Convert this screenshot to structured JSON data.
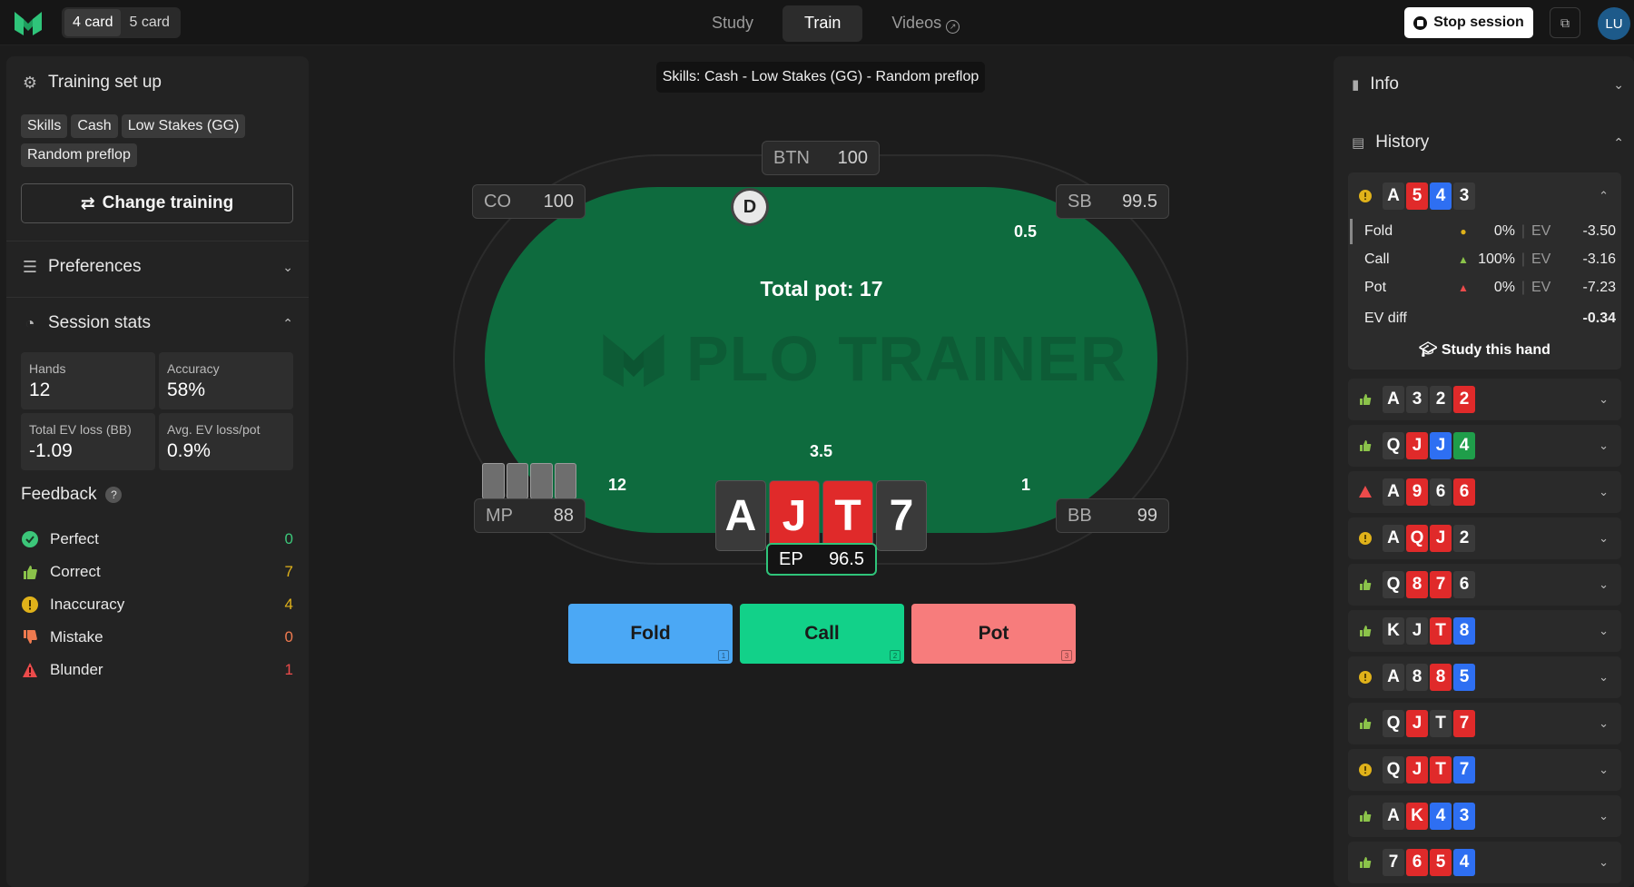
{
  "topbar": {
    "card_modes": [
      "4 card",
      "5 card"
    ],
    "active_mode": "4 card",
    "tabs": [
      "Study",
      "Train",
      "Videos"
    ],
    "active_tab": "Train",
    "stop_label": "Stop session",
    "avatar": "LU"
  },
  "training": {
    "title": "Training set up",
    "tags": [
      "Skills",
      "Cash",
      "Low Stakes (GG)",
      "Random preflop"
    ],
    "change_label": "Change training"
  },
  "preferences": {
    "title": "Preferences"
  },
  "session": {
    "title": "Session stats",
    "hands_label": "Hands",
    "hands": "12",
    "accuracy_label": "Accuracy",
    "accuracy": "58%",
    "evloss_label": "Total EV loss (BB)",
    "evloss": "-1.09",
    "avgloss_label": "Avg. EV loss/pot",
    "avgloss": "0.9%"
  },
  "feedback": {
    "title": "Feedback",
    "rows": [
      {
        "label": "Perfect",
        "count": "0",
        "color": "#3cc77a"
      },
      {
        "label": "Correct",
        "count": "7",
        "color": "#8bc34a"
      },
      {
        "label": "Inaccuracy",
        "count": "4",
        "color": "#e0b21a"
      },
      {
        "label": "Mistake",
        "count": "0",
        "color": "#ef7a4f"
      },
      {
        "label": "Blunder",
        "count": "1",
        "color": "#ec4b4b"
      }
    ]
  },
  "table": {
    "banner": "Skills: Cash - Low Stakes (GG) - Random preflop",
    "watermark": "PLO TRAINER",
    "pot": "Total pot: 17",
    "dealer": "D",
    "seats": {
      "btn": {
        "pos": "BTN",
        "stack": "100"
      },
      "co": {
        "pos": "CO",
        "stack": "100"
      },
      "sb": {
        "pos": "SB",
        "stack": "99.5"
      },
      "mp": {
        "pos": "MP",
        "stack": "88"
      },
      "bb": {
        "pos": "BB",
        "stack": "99"
      },
      "ep": {
        "pos": "EP",
        "stack": "96.5"
      }
    },
    "bets": {
      "sb": "0.5",
      "ep": "3.5",
      "mp": "12",
      "bb": "1"
    },
    "hero_cards": [
      {
        "rank": "A",
        "suit_color": "#3a3a3a"
      },
      {
        "rank": "J",
        "suit_color": "#e02a2a"
      },
      {
        "rank": "T",
        "suit_color": "#e02a2a"
      },
      {
        "rank": "7",
        "suit_color": "#3a3a3a"
      }
    ],
    "actions": [
      {
        "label": "Fold",
        "key": "1",
        "color": "#4ba8f5"
      },
      {
        "label": "Call",
        "key": "2",
        "color": "#12d189"
      },
      {
        "label": "Pot",
        "key": "3",
        "color": "#f77c7c"
      }
    ]
  },
  "info": {
    "title": "Info"
  },
  "history": {
    "title": "History",
    "expanded": {
      "cards": [
        {
          "rank": "A",
          "color": "#3a3a3a"
        },
        {
          "rank": "5",
          "color": "#e02a2a"
        },
        {
          "rank": "4",
          "color": "#2e6ff2"
        },
        {
          "rank": "3",
          "color": "#3a3a3a"
        }
      ],
      "rows": [
        {
          "action": "Fold",
          "pct": "0%",
          "ev_label": "EV",
          "ev": "-3.50"
        },
        {
          "action": "Call",
          "pct": "100%",
          "ev_label": "EV",
          "ev": "-3.16"
        },
        {
          "action": "Pot",
          "pct": "0%",
          "ev_label": "EV",
          "ev": "-7.23"
        }
      ],
      "evdiff_label": "EV diff",
      "evdiff": "-0.34",
      "study_label": "Study this hand"
    },
    "hands": [
      {
        "result": "correct",
        "cards": [
          [
            "A",
            "#3a3a3a"
          ],
          [
            "3",
            "#3a3a3a"
          ],
          [
            "2",
            "#3a3a3a"
          ],
          [
            "2",
            "#e02a2a"
          ]
        ]
      },
      {
        "result": "correct",
        "cards": [
          [
            "Q",
            "#3a3a3a"
          ],
          [
            "J",
            "#e02a2a"
          ],
          [
            "J",
            "#2e6ff2"
          ],
          [
            "4",
            "#1f9e4a"
          ]
        ]
      },
      {
        "result": "blunder",
        "cards": [
          [
            "A",
            "#3a3a3a"
          ],
          [
            "9",
            "#e02a2a"
          ],
          [
            "6",
            "#3a3a3a"
          ],
          [
            "6",
            "#e02a2a"
          ]
        ]
      },
      {
        "result": "inaccuracy",
        "cards": [
          [
            "A",
            "#3a3a3a"
          ],
          [
            "Q",
            "#e02a2a"
          ],
          [
            "J",
            "#e02a2a"
          ],
          [
            "2",
            "#3a3a3a"
          ]
        ]
      },
      {
        "result": "correct",
        "cards": [
          [
            "Q",
            "#3a3a3a"
          ],
          [
            "8",
            "#e02a2a"
          ],
          [
            "7",
            "#e02a2a"
          ],
          [
            "6",
            "#3a3a3a"
          ]
        ]
      },
      {
        "result": "correct",
        "cards": [
          [
            "K",
            "#3a3a3a"
          ],
          [
            "J",
            "#3a3a3a"
          ],
          [
            "T",
            "#e02a2a"
          ],
          [
            "8",
            "#2e6ff2"
          ]
        ]
      },
      {
        "result": "inaccuracy",
        "cards": [
          [
            "A",
            "#3a3a3a"
          ],
          [
            "8",
            "#3a3a3a"
          ],
          [
            "8",
            "#e02a2a"
          ],
          [
            "5",
            "#2e6ff2"
          ]
        ]
      },
      {
        "result": "correct",
        "cards": [
          [
            "Q",
            "#3a3a3a"
          ],
          [
            "J",
            "#e02a2a"
          ],
          [
            "T",
            "#3a3a3a"
          ],
          [
            "7",
            "#e02a2a"
          ]
        ]
      },
      {
        "result": "inaccuracy",
        "cards": [
          [
            "Q",
            "#3a3a3a"
          ],
          [
            "J",
            "#e02a2a"
          ],
          [
            "T",
            "#e02a2a"
          ],
          [
            "7",
            "#2e6ff2"
          ]
        ]
      },
      {
        "result": "correct",
        "cards": [
          [
            "A",
            "#3a3a3a"
          ],
          [
            "K",
            "#e02a2a"
          ],
          [
            "4",
            "#2e6ff2"
          ],
          [
            "3",
            "#2e6ff2"
          ]
        ]
      },
      {
        "result": "correct",
        "cards": [
          [
            "7",
            "#3a3a3a"
          ],
          [
            "6",
            "#e02a2a"
          ],
          [
            "5",
            "#e02a2a"
          ],
          [
            "4",
            "#2e6ff2"
          ]
        ]
      }
    ]
  }
}
